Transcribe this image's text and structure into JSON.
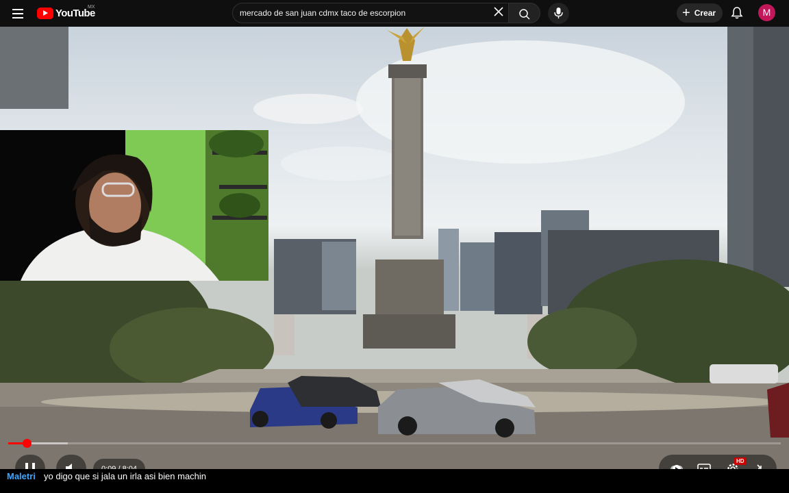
{
  "header": {
    "logo_text": "YouTube",
    "logo_country": "MX",
    "search": {
      "value": "mercado de san juan cdmx taco de escorpion"
    },
    "create_label": "Crear",
    "avatar_initial": "M"
  },
  "player": {
    "time_current": "0:09",
    "time_separator": " / ",
    "time_duration": "8:04",
    "quality_badge": "HD",
    "progress_played_fraction": 0.024,
    "progress_loaded_fraction": 0.077
  },
  "chat": {
    "author": "Maletri",
    "message": "yo digo que si jala un irla asi bien machin"
  },
  "colors": {
    "brand_red": "#ff0000",
    "link_blue": "#3ea6ff",
    "background": "#0f0f0f"
  },
  "icons": [
    "menu-icon",
    "youtube-logo-icon",
    "close-icon",
    "search-icon",
    "mic-icon",
    "plus-icon",
    "bell-icon",
    "pause-icon",
    "volume-icon",
    "play-next-icon",
    "captions-icon",
    "settings-icon",
    "exit-fullscreen-icon"
  ]
}
